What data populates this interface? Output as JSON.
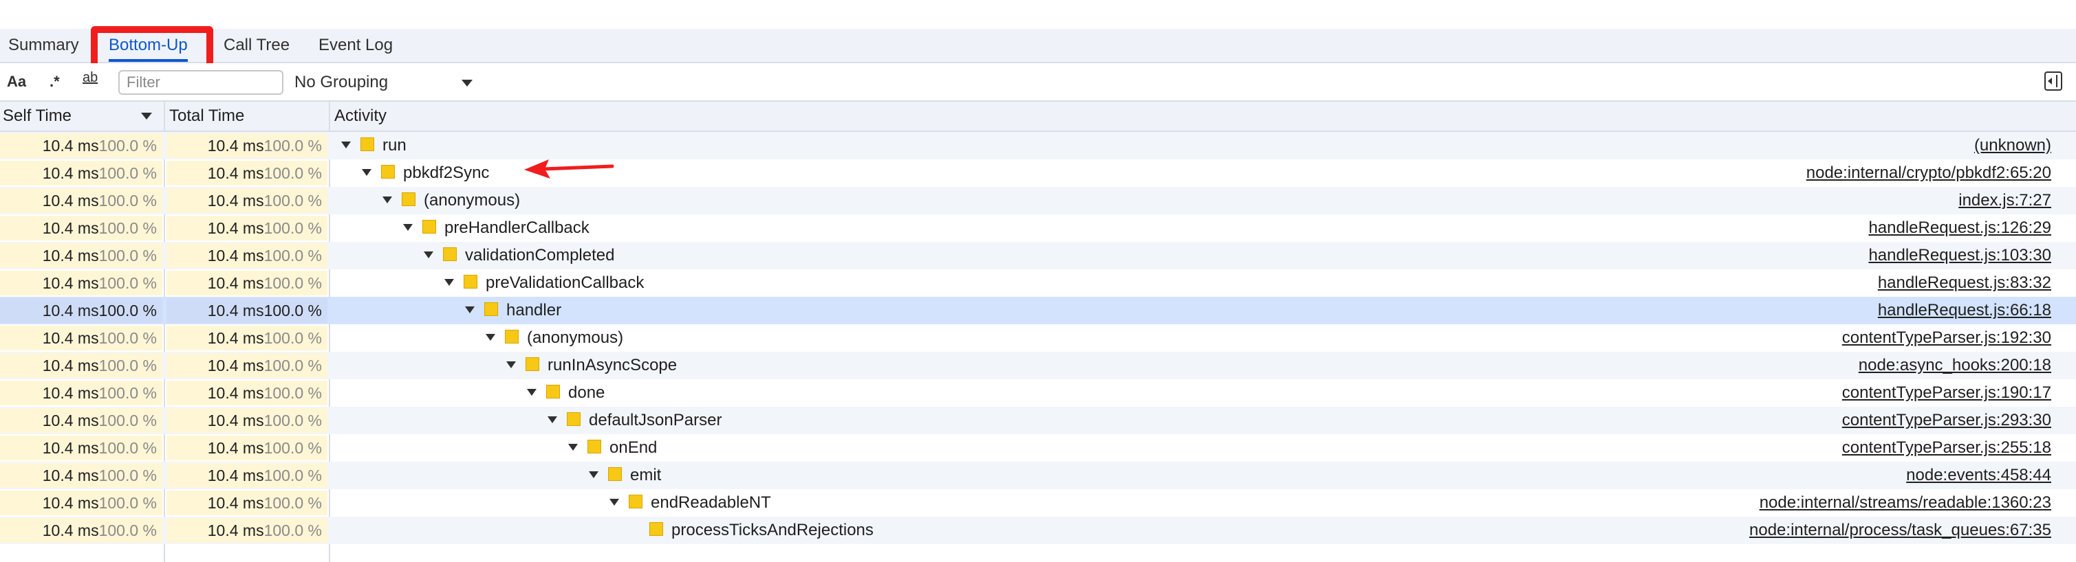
{
  "tabs": [
    {
      "label": "Summary",
      "active": false
    },
    {
      "label": "Bottom-Up",
      "active": true
    },
    {
      "label": "Call Tree",
      "active": false
    },
    {
      "label": "Event Log",
      "active": false
    }
  ],
  "toolbar": {
    "match_case_label": "Aa",
    "regex_label": ".*",
    "whole_word_label": "ab",
    "filter_placeholder": "Filter",
    "grouping": "No Grouping",
    "icons": [
      "match-case-icon",
      "regex-icon",
      "whole-word-icon",
      "toggle-sidebar-icon"
    ]
  },
  "columns": {
    "self": "Self Time",
    "total": "Total Time",
    "activity": "Activity"
  },
  "colors": {
    "accent": "#0b57d0",
    "annotation": "#f11d1d",
    "function_square": "#f7c815",
    "selected_row": "#d3e3fd"
  },
  "rows": [
    {
      "self_ms": "10.4 ms",
      "self_pct": "100.0 %",
      "total_ms": "10.4 ms",
      "total_pct": "100.0 %",
      "name": "run",
      "source": "(unknown)",
      "depth": 0,
      "expandable": true
    },
    {
      "self_ms": "10.4 ms",
      "self_pct": "100.0 %",
      "total_ms": "10.4 ms",
      "total_pct": "100.0 %",
      "name": "pbkdf2Sync",
      "source": "node:internal/crypto/pbkdf2:65:20",
      "depth": 1,
      "expandable": true
    },
    {
      "self_ms": "10.4 ms",
      "self_pct": "100.0 %",
      "total_ms": "10.4 ms",
      "total_pct": "100.0 %",
      "name": "(anonymous)",
      "source": "index.js:7:27",
      "depth": 2,
      "expandable": true
    },
    {
      "self_ms": "10.4 ms",
      "self_pct": "100.0 %",
      "total_ms": "10.4 ms",
      "total_pct": "100.0 %",
      "name": "preHandlerCallback",
      "source": "handleRequest.js:126:29",
      "depth": 3,
      "expandable": true
    },
    {
      "self_ms": "10.4 ms",
      "self_pct": "100.0 %",
      "total_ms": "10.4 ms",
      "total_pct": "100.0 %",
      "name": "validationCompleted",
      "source": "handleRequest.js:103:30",
      "depth": 4,
      "expandable": true
    },
    {
      "self_ms": "10.4 ms",
      "self_pct": "100.0 %",
      "total_ms": "10.4 ms",
      "total_pct": "100.0 %",
      "name": "preValidationCallback",
      "source": "handleRequest.js:83:32",
      "depth": 5,
      "expandable": true
    },
    {
      "self_ms": "10.4 ms",
      "self_pct": "100.0 %",
      "total_ms": "10.4 ms",
      "total_pct": "100.0 %",
      "name": "handler",
      "source": "handleRequest.js:66:18",
      "depth": 6,
      "expandable": true,
      "selected": true
    },
    {
      "self_ms": "10.4 ms",
      "self_pct": "100.0 %",
      "total_ms": "10.4 ms",
      "total_pct": "100.0 %",
      "name": "(anonymous)",
      "source": "contentTypeParser.js:192:30",
      "depth": 7,
      "expandable": true
    },
    {
      "self_ms": "10.4 ms",
      "self_pct": "100.0 %",
      "total_ms": "10.4 ms",
      "total_pct": "100.0 %",
      "name": "runInAsyncScope",
      "source": "node:async_hooks:200:18",
      "depth": 8,
      "expandable": true
    },
    {
      "self_ms": "10.4 ms",
      "self_pct": "100.0 %",
      "total_ms": "10.4 ms",
      "total_pct": "100.0 %",
      "name": "done",
      "source": "contentTypeParser.js:190:17",
      "depth": 9,
      "expandable": true
    },
    {
      "self_ms": "10.4 ms",
      "self_pct": "100.0 %",
      "total_ms": "10.4 ms",
      "total_pct": "100.0 %",
      "name": "defaultJsonParser",
      "source": "contentTypeParser.js:293:30",
      "depth": 10,
      "expandable": true
    },
    {
      "self_ms": "10.4 ms",
      "self_pct": "100.0 %",
      "total_ms": "10.4 ms",
      "total_pct": "100.0 %",
      "name": "onEnd",
      "source": "contentTypeParser.js:255:18",
      "depth": 11,
      "expandable": true
    },
    {
      "self_ms": "10.4 ms",
      "self_pct": "100.0 %",
      "total_ms": "10.4 ms",
      "total_pct": "100.0 %",
      "name": "emit",
      "source": "node:events:458:44",
      "depth": 12,
      "expandable": true
    },
    {
      "self_ms": "10.4 ms",
      "self_pct": "100.0 %",
      "total_ms": "10.4 ms",
      "total_pct": "100.0 %",
      "name": "endReadableNT",
      "source": "node:internal/streams/readable:1360:23",
      "depth": 13,
      "expandable": true
    },
    {
      "self_ms": "10.4 ms",
      "self_pct": "100.0 %",
      "total_ms": "10.4 ms",
      "total_pct": "100.0 %",
      "name": "processTicksAndRejections",
      "source": "node:internal/process/task_queues:67:35",
      "depth": 14,
      "expandable": false
    }
  ]
}
